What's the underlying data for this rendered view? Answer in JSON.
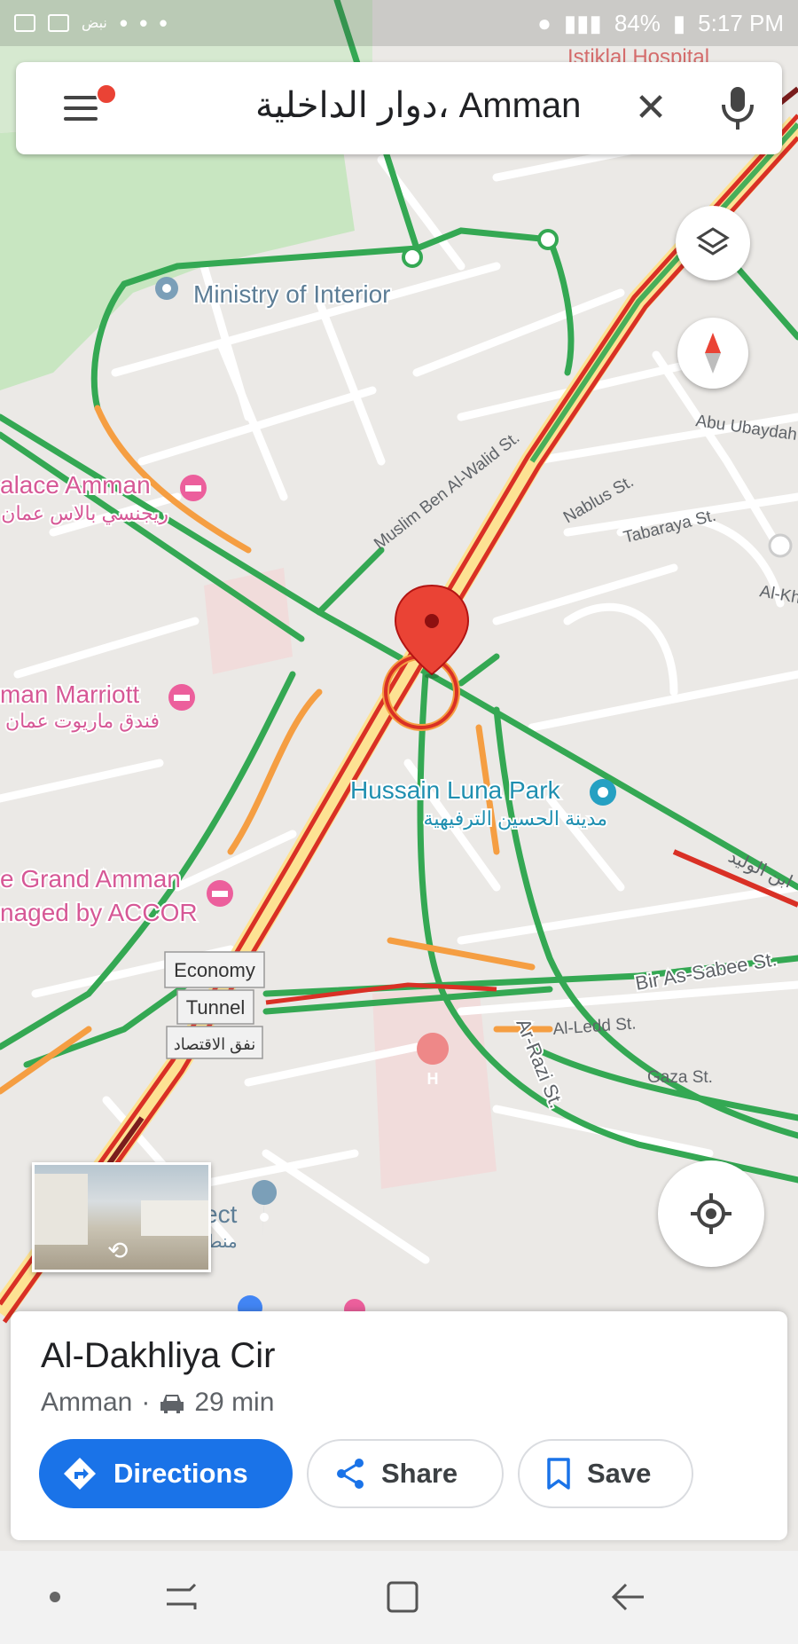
{
  "status_bar": {
    "carrier_text": "نبض",
    "dots": "• • •",
    "battery": "84%",
    "time": "5:17 PM"
  },
  "search": {
    "query": "دوار الداخلية، Amman"
  },
  "map": {
    "labels": {
      "istiklal_hospital": "Istiklal Hospital",
      "ministry_interior": "Ministry of Interior",
      "regency_palace_en": "alace Amman",
      "regency_palace_ar": "ريجنسي بالاس عمان",
      "marriott_en": "man Marriott",
      "marriott_ar": "فندق ماريوت عمان",
      "grand_amman_1": "e Grand Amman",
      "grand_amman_2": "naged by ACCOR",
      "luna_park_en": "Hussain Luna Park",
      "luna_park_ar": "مدينة الحسين الترفيهية",
      "muslim_st": "Muslim Ben Al-Walid St.",
      "nablus_st": "Nablus St.",
      "tabaraya_st": "Tabaraya St.",
      "abu_ubaydah": "Abu Ubaydah",
      "al_kh": "Al-Kh",
      "bir_sabee": "Bir As-Sabee St.",
      "al_ledd": "Al-Ledd St.",
      "gaza_st": "Gaza St.",
      "ar_razi": "Ar-Razi St.",
      "economy": "Economy",
      "tunnel": "Tunnel",
      "tunnel_ar": "نفق الاقتصاد",
      "project_en": "ect",
      "project_ar": "منط",
      "al_waleed_ar": "ابن الوليد"
    }
  },
  "place_card": {
    "title": "Al-Dakhliya Cir",
    "city": "Amman",
    "separator": "·",
    "drive_time": "29 min",
    "directions_label": "Directions",
    "share_label": "Share",
    "save_label": "Save"
  },
  "icons": {
    "accent": "#1a73e8",
    "pin": "#ea4335",
    "traffic_fast": "#34a853",
    "traffic_medium": "#f59e42",
    "traffic_slow": "#d93025",
    "traffic_jam": "#7a1d1d"
  }
}
